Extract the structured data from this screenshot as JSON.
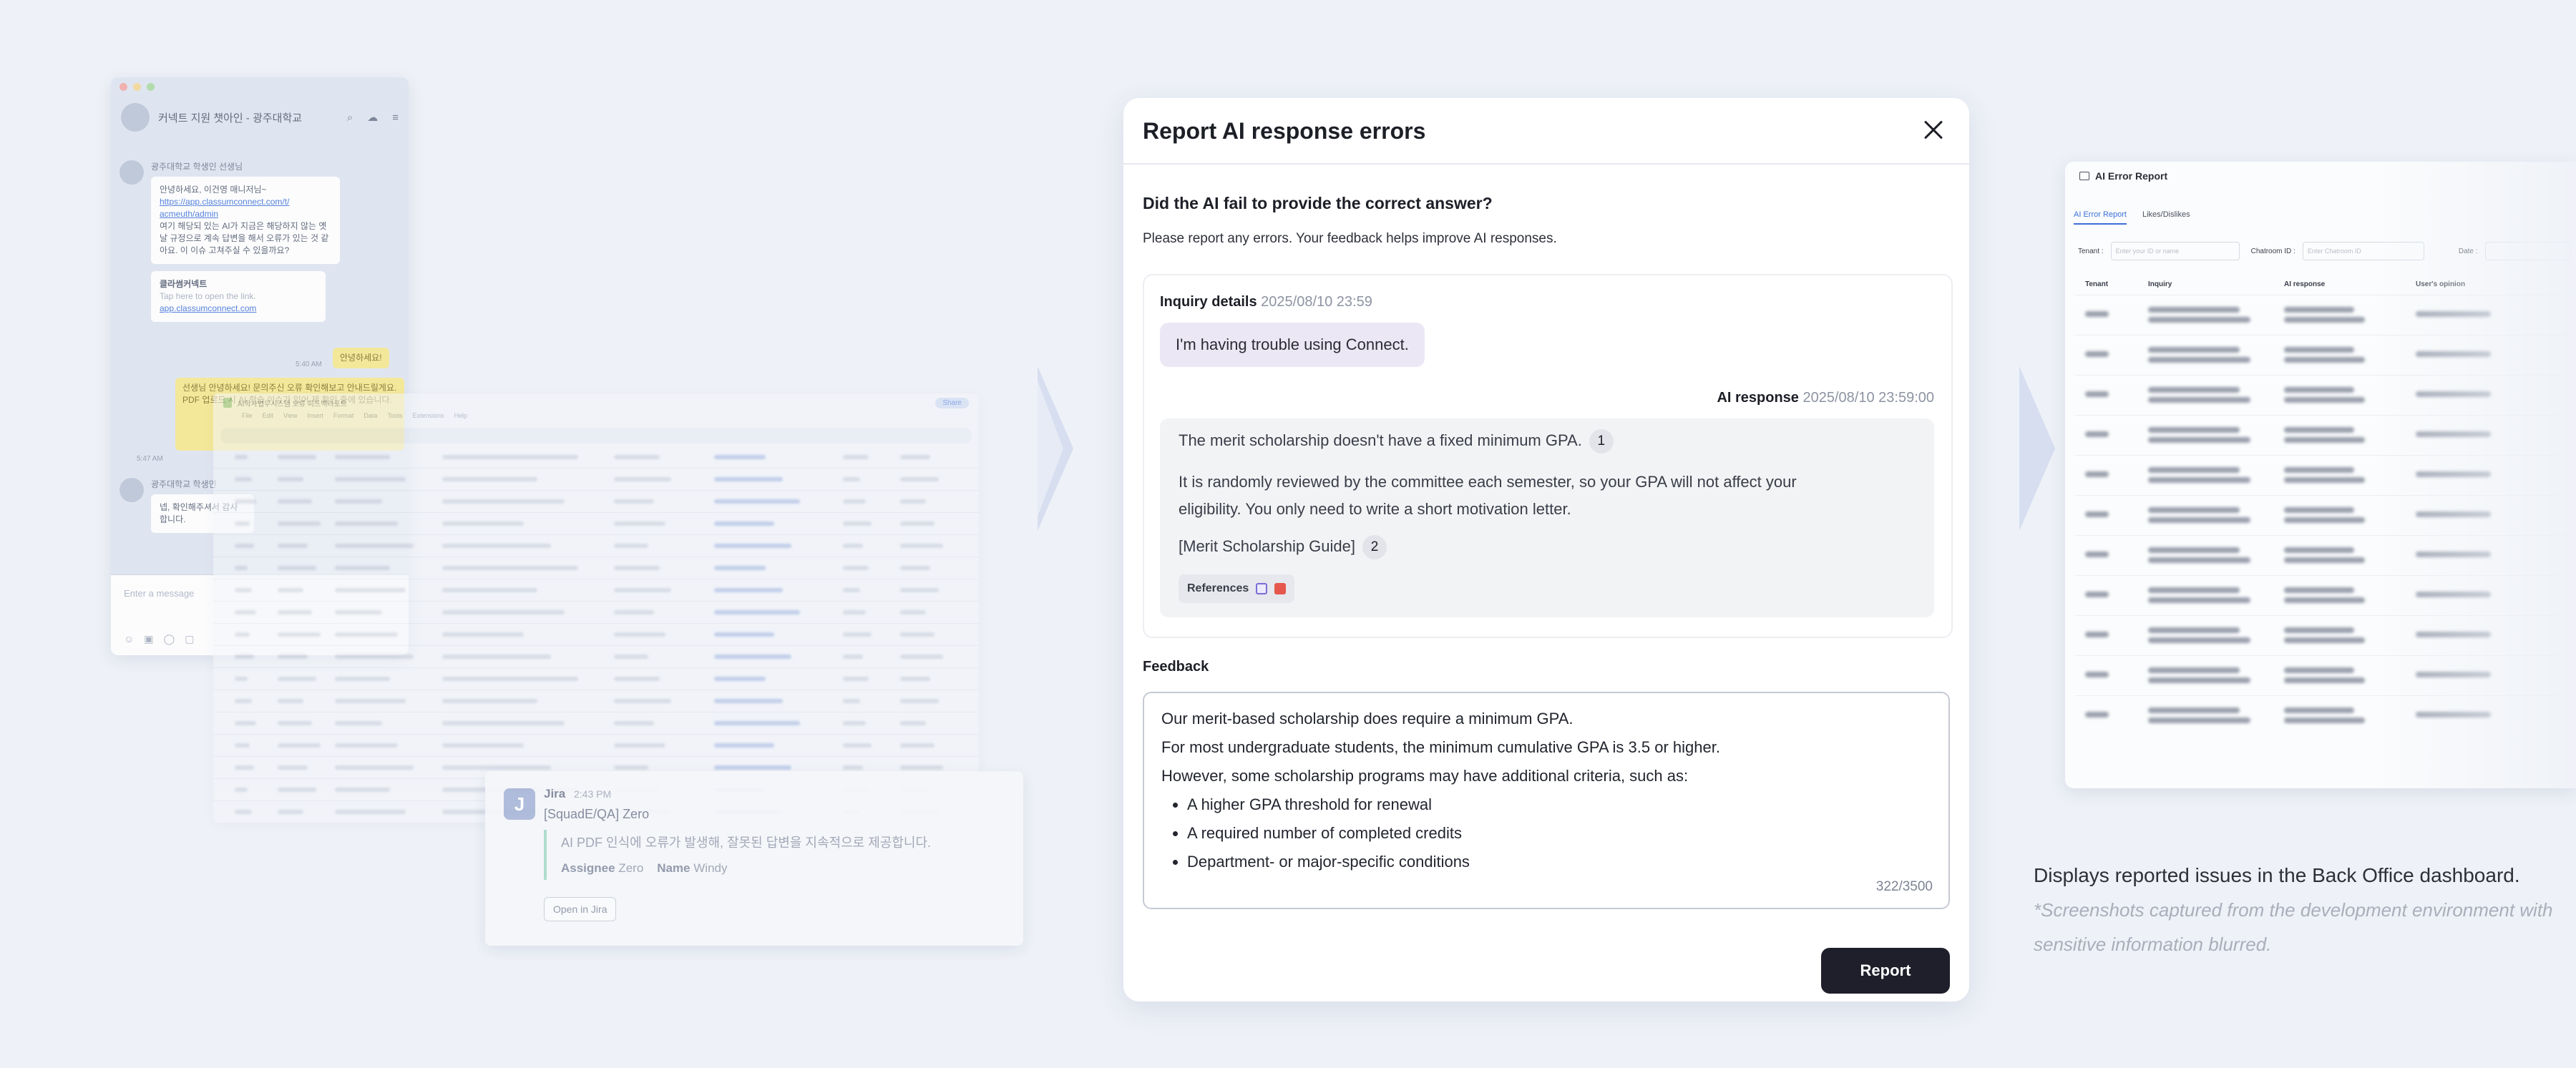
{
  "chat": {
    "title": "커넥트 지원 챗아인 - 광주대학교",
    "sender_bot": "광주대학교 학생인 선생님",
    "bubble1_line1": "안녕하세요, 이건영 매니저님~",
    "bubble1_link1": "https://app.classumconnect.com/t/",
    "bubble1_link2": "acmeuth/admin",
    "bubble1_rest": "여기 해당되 있는 AI가 지금은 해당하지 않는 옛날 규정으로 계속 답변을 해서 오류가 있는 것 같아요. 이 이슈 고쳐주실 수 있을까요?",
    "bubble2_title": "클라썸커넥트",
    "bubble2_sub": "Tap here to open the link.",
    "bubble2_link": "app.classumconnect.com",
    "time1": "5:40 AM",
    "yellow1": "안녕하세요!",
    "yellow2": "선생님 안녕하세요! 문의주신 오류 확인해보고 안내드릴게요. PDF 업로드 시 AI 학습 이슈가 있어 제 확인 중에 있습니다.",
    "time2": "5:47 AM",
    "sender_bot2": "광주대학교 학생인",
    "bubble3": "넵, 확인해주셔서 감사합니다.",
    "input_placeholder": "Enter a message"
  },
  "sheet": {
    "title": "AI학사업무시스템 오류 피드백리포트",
    "share": "Share",
    "menu": [
      "File",
      "Edit",
      "View",
      "Insert",
      "Format",
      "Data",
      "Tools",
      "Extensions",
      "Help"
    ]
  },
  "jira": {
    "name": "Jira",
    "time": "2:43 PM",
    "ticket": "[SquadE/QA] Zero",
    "description": "AI PDF 인식에 오류가 발생해, 잘못된 답변을 지속적으로 제공합니다.",
    "assignee_label": "Assignee",
    "assignee_value": "Zero",
    "name_label": "Name",
    "name_value": "Windy",
    "open_button": "Open in Jira"
  },
  "modal": {
    "title": "Report AI response errors",
    "question": "Did the AI fail to provide the correct answer?",
    "subtitle": "Please report any errors. Your feedback helps improve AI responses.",
    "inquiry_label": "Inquiry details",
    "inquiry_date": "2025/08/10 23:59",
    "inquiry_message": "I'm having trouble using Connect.",
    "ai_label": "AI response",
    "ai_date": "2025/08/10 23:59:00",
    "ai_line1": "The merit scholarship doesn't have a fixed minimum GPA.",
    "cite1": "1",
    "ai_line2": "It is randomly reviewed by the committee each semester, so your GPA will not affect your",
    "ai_line3": "eligibility. You only need to write a short motivation letter.",
    "ai_line4": "[Merit Scholarship Guide]",
    "cite2": "2",
    "references_label": "References",
    "feedback_label": "Feedback",
    "feedback_lines": [
      "Our merit-based scholarship does require a minimum GPA.",
      "For most undergraduate students, the minimum cumulative GPA is 3.5 or higher.",
      "However, some scholarship programs may have additional criteria, such as:"
    ],
    "feedback_bullets": [
      "A higher GPA threshold for renewal",
      "A required number of completed credits",
      "Department- or major-specific conditions"
    ],
    "char_count": "322/3500",
    "report_button": "Report"
  },
  "backoffice": {
    "title": "AI Error Report",
    "tab_active": "AI Error Report",
    "tab2": "Likes/Dislikes",
    "filter_tenant": "Tenant :",
    "filter_tenant_ph": "Enter your ID or name",
    "filter_chatroom": "Chatroom ID :",
    "filter_chatroom_ph": "Enter Chatroom ID",
    "filter_date": "Date :",
    "col_tenant": "Tenant",
    "col_inquiry": "Inquiry",
    "col_ai": "AI response",
    "col_opinion": "User's opinion"
  },
  "caption": {
    "main": "Displays reported issues in the Back Office dashboard.",
    "note": "*Screenshots captured from the development environment with sensitive information blurred."
  },
  "colors": {
    "accent": "#1e1f2a",
    "link": "#3b6fd8",
    "user_bubble": "#ece7f4"
  }
}
